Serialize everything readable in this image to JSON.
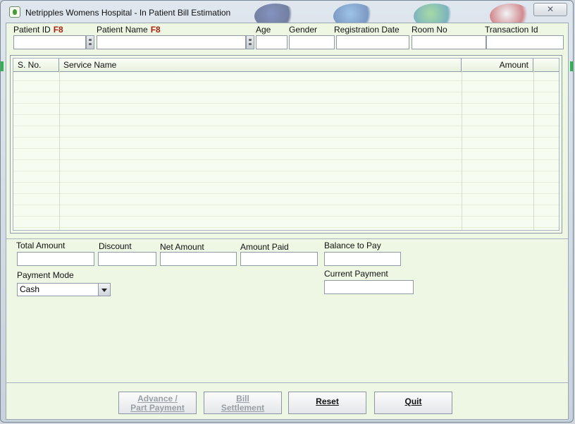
{
  "window": {
    "title": "Netripples Womens Hospital - In Patient Bill Estimation",
    "close_glyph": "✕"
  },
  "header": {
    "patient_id": {
      "label": "Patient ID",
      "hotkey": "F8",
      "value": ""
    },
    "patient_name": {
      "label": "Patient Name",
      "hotkey": "F8",
      "value": ""
    },
    "age": {
      "label": "Age",
      "value": ""
    },
    "gender": {
      "label": "Gender",
      "value": ""
    },
    "registration_date": {
      "label": "Registration Date",
      "value": ""
    },
    "room_no": {
      "label": "Room No",
      "value": ""
    },
    "transaction_id": {
      "label": "Transaction Id",
      "value": ""
    }
  },
  "grid": {
    "columns": [
      "S. No.",
      "Service Name",
      "Amount"
    ],
    "rows": []
  },
  "summary": {
    "total_amount": {
      "label": "Total Amount",
      "value": ""
    },
    "discount": {
      "label": "Discount",
      "value": ""
    },
    "net_amount": {
      "label": "Net Amount",
      "value": ""
    },
    "amount_paid": {
      "label": "Amount Paid",
      "value": ""
    },
    "balance_to_pay": {
      "label": "Balance to Pay",
      "value": ""
    },
    "current_payment": {
      "label": "Current Payment",
      "value": ""
    },
    "payment_mode": {
      "label": "Payment Mode",
      "selected": "Cash"
    }
  },
  "buttons": {
    "advance_line1": "Advance /",
    "advance_line2": "Part Payment",
    "bill_line1": "Bill",
    "bill_line2": "Settlement",
    "reset": "Reset",
    "quit": "Quit"
  },
  "colors": {
    "client_bg": "#eef7e3",
    "hotkey": "#b02010",
    "disabled_text": "#9aa0a6"
  }
}
